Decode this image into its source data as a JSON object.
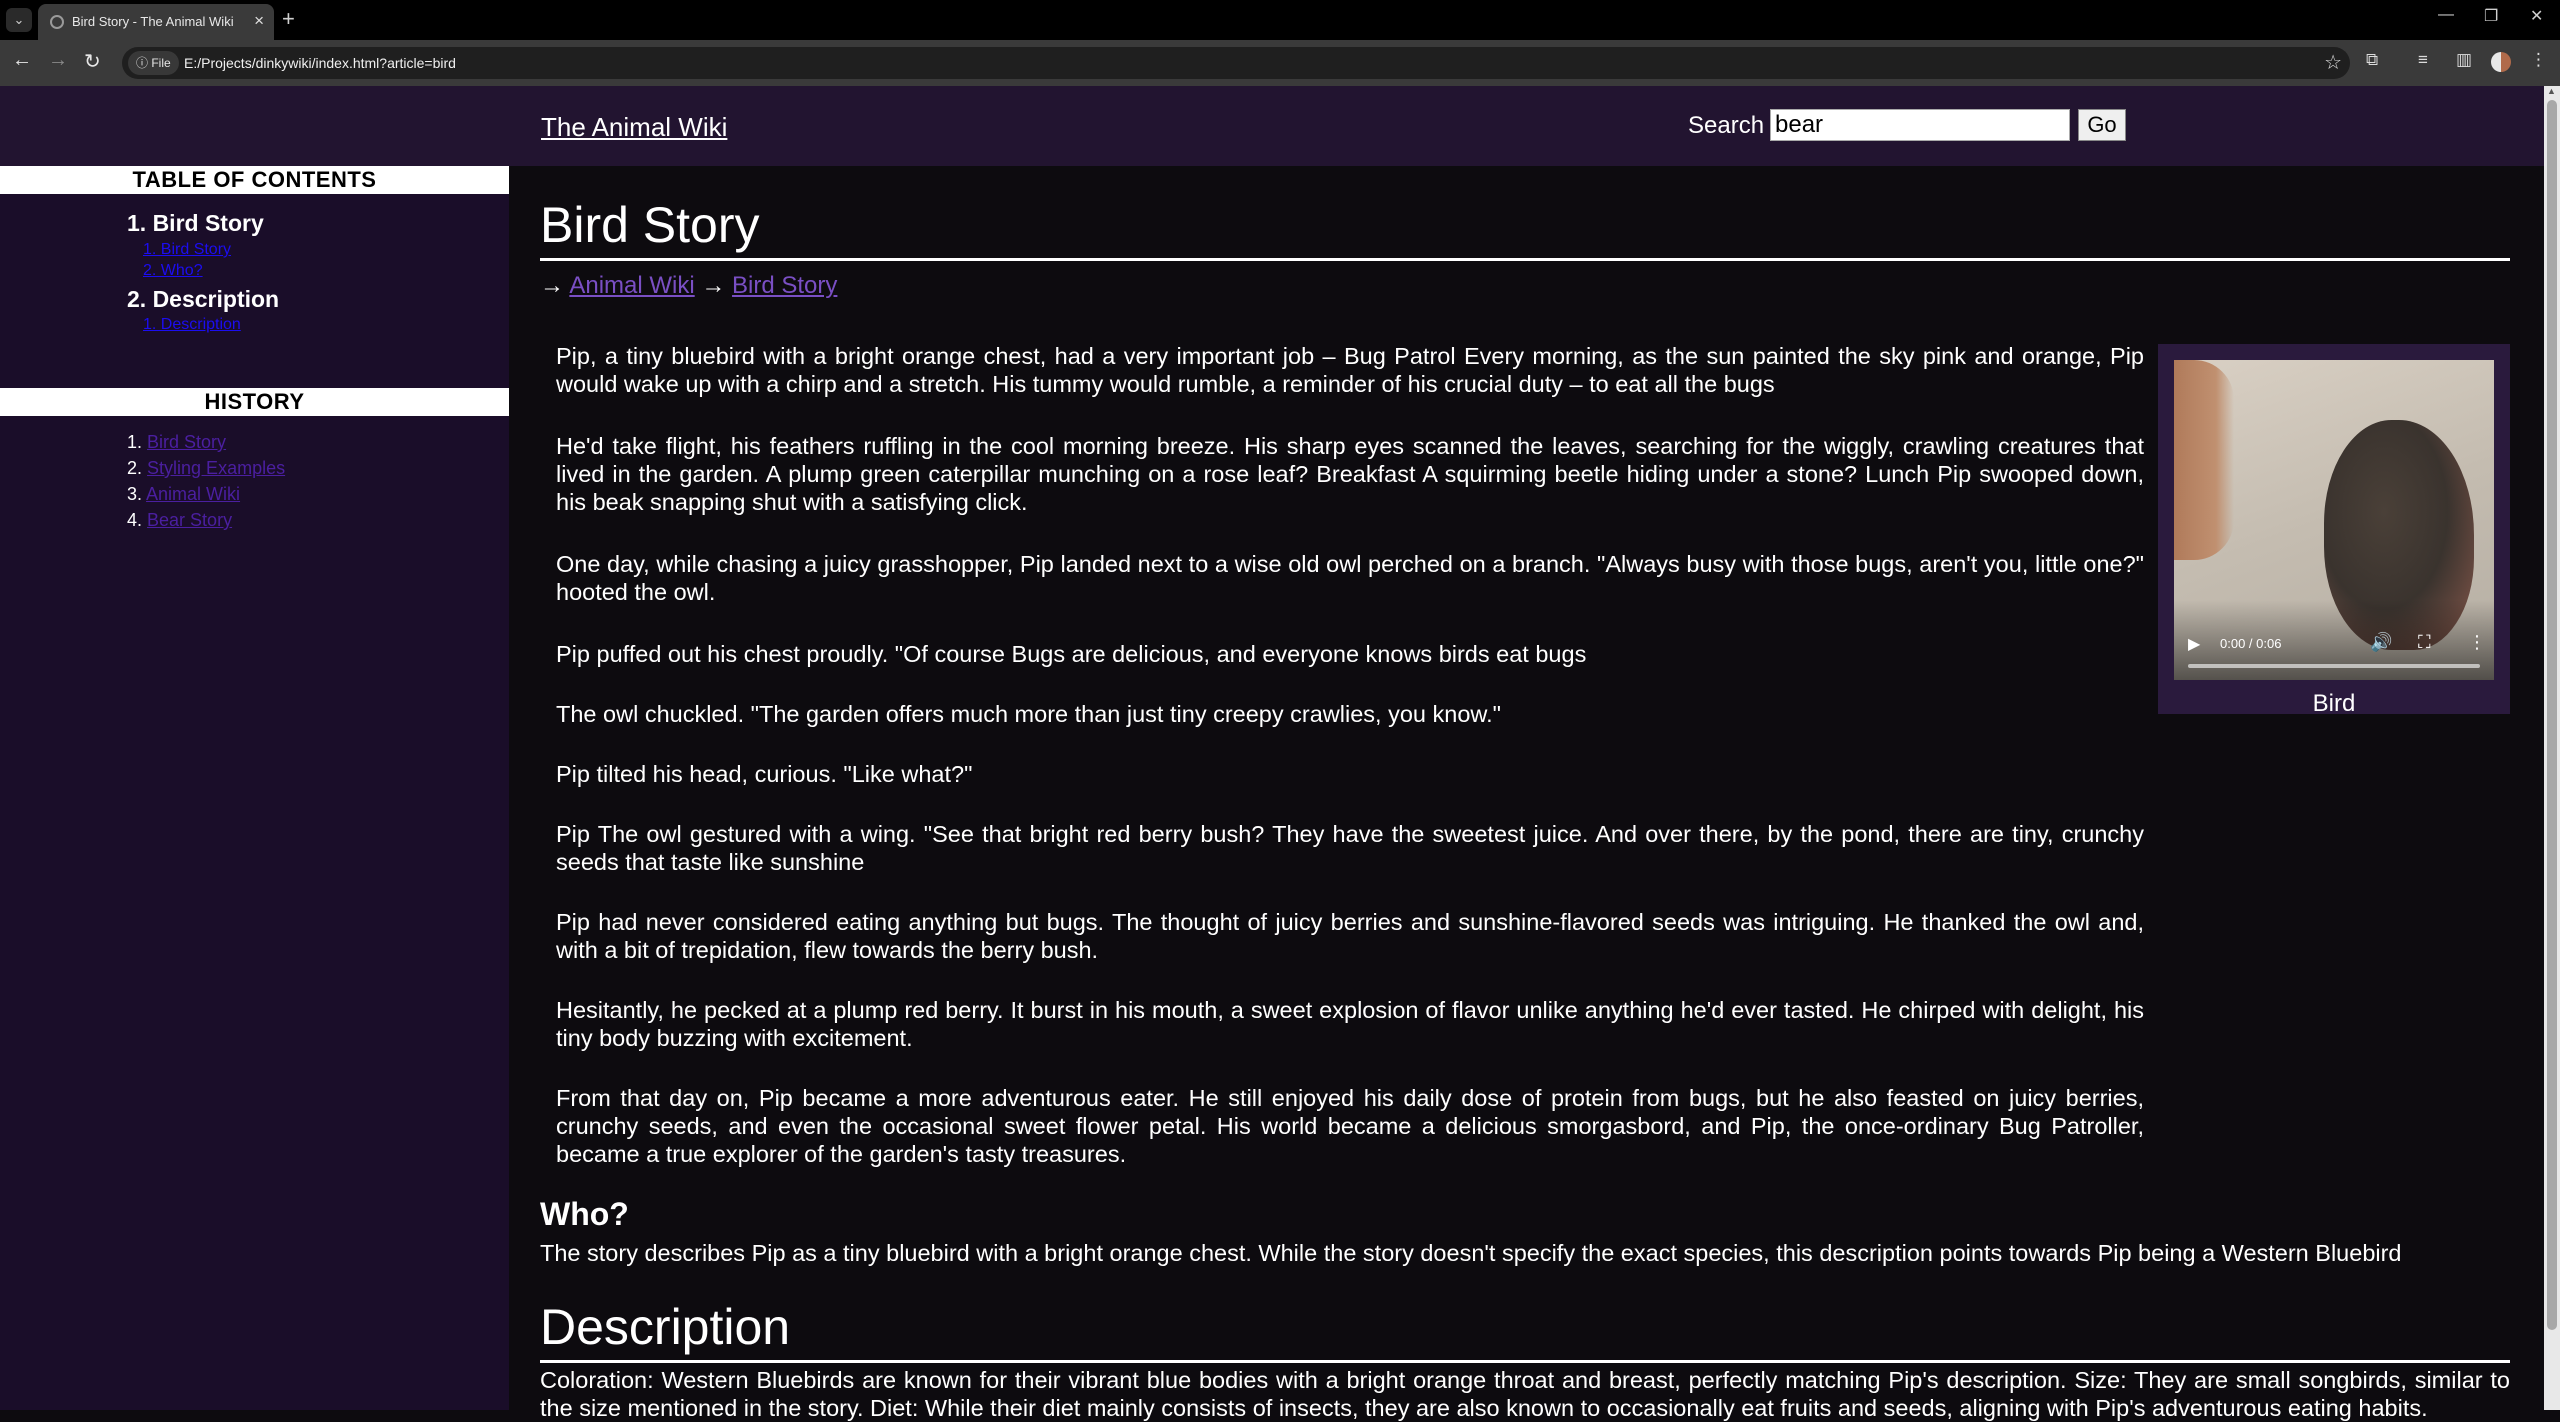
{
  "browser": {
    "tab_title": "Bird Story - The Animal Wiki",
    "site_chip": "File",
    "url": "E:/Projects/dinkywiki/index.html?article=bird"
  },
  "header": {
    "site_title": "The Animal Wiki",
    "search_label": "Search",
    "search_value": "bear",
    "go_label": "Go"
  },
  "sidebar": {
    "toc_heading": "TABLE OF CONTENTS",
    "toc": [
      {
        "label": "1. Bird Story",
        "sub": [
          "1. Bird Story",
          "2. Who?"
        ]
      },
      {
        "label": "2. Description",
        "sub": [
          "1. Description"
        ]
      }
    ],
    "history_heading": "HISTORY",
    "history": [
      {
        "num": "1.",
        "label": "Bird Story"
      },
      {
        "num": "2.",
        "label": "Styling Examples"
      },
      {
        "num": "3.",
        "label": "Animal Wiki"
      },
      {
        "num": "4.",
        "label": "Bear Story"
      }
    ]
  },
  "article": {
    "title": "Bird Story",
    "breadcrumb_arrow": "→",
    "breadcrumb": [
      "Animal Wiki",
      "Bird Story"
    ],
    "paragraphs": [
      "Pip, a tiny bluebird with a bright orange chest, had a very important job – Bug Patrol Every morning, as the sun painted the sky pink and orange, Pip would wake up with a chirp and a stretch. His tummy would rumble, a reminder of his crucial duty – to eat all the bugs",
      "He'd take flight, his feathers ruffling in the cool morning breeze. His sharp eyes scanned the leaves, searching for the wiggly, crawling creatures that lived in the garden. A plump green caterpillar munching on a rose leaf? Breakfast A squirming beetle hiding under a stone? Lunch Pip swooped down, his beak snapping shut with a satisfying click.",
      "One day, while chasing a juicy grasshopper, Pip landed next to a wise old owl perched on a branch. \"Always busy with those bugs, aren't you, little one?\" hooted the owl.",
      "Pip puffed out his chest proudly. \"Of course Bugs are delicious, and everyone knows birds eat bugs",
      "The owl chuckled. \"The garden offers much more than just tiny creepy crawlies, you know.\"",
      "Pip tilted his head, curious. \"Like what?\"",
      "Pip The owl gestured with a wing. \"See that bright red berry bush? They have the sweetest juice. And over there, by the pond, there are tiny, crunchy seeds that taste like sunshine",
      "Pip had never considered eating anything but bugs. The thought of juicy berries and sunshine-flavored seeds was intriguing. He thanked the owl and, with a bit of trepidation, flew towards the berry bush.",
      "Hesitantly, he pecked at a plump red berry. It burst in his mouth, a sweet explosion of flavor unlike anything he'd ever tasted. He chirped with delight, his tiny body buzzing with excitement.",
      "From that day on, Pip became a more adventurous eater. He still enjoyed his daily dose of protein from bugs, but he also feasted on juicy berries, crunchy seeds, and even the occasional sweet flower petal. His world became a delicious smorgasbord, and Pip, the once-ordinary Bug Patroller, became a true explorer of the garden's tasty treasures."
    ],
    "figure": {
      "video_time": "0:00 / 0:06",
      "caption": "Bird"
    },
    "who_heading": "Who?",
    "who_text": "The story describes Pip as a tiny bluebird with a bright orange chest. While the story doesn't specify the exact species, this description points towards Pip being a Western Bluebird",
    "description_heading": "Description",
    "description_text": "Coloration: Western Bluebirds are known for their vibrant blue bodies with a bright orange throat and breast, perfectly matching Pip's description. Size: They are small songbirds, similar to the size mentioned in the story. Diet: While their diet mainly consists of insects, they are also known to occasionally eat fruits and seeds, aligning with Pip's adventurous eating habits."
  }
}
